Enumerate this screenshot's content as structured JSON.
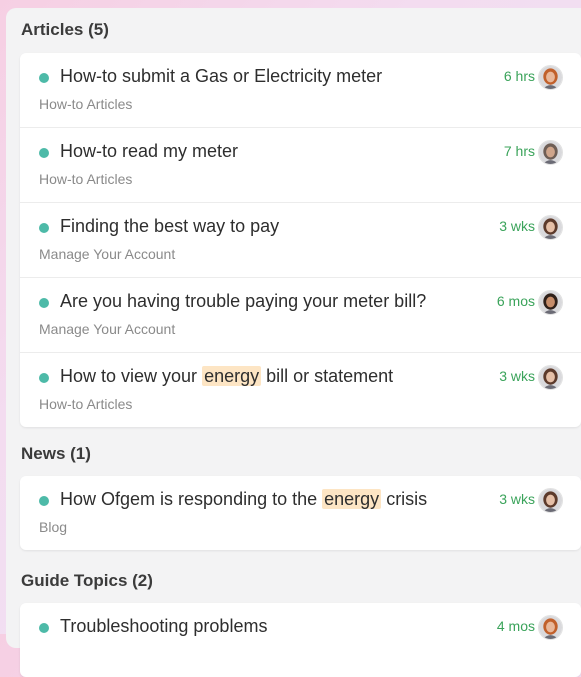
{
  "sections": [
    {
      "heading": "Articles (5)",
      "items": [
        {
          "title_pre": "How-to submit a Gas or Electricity meter",
          "title_hl": "",
          "title_post": "",
          "category": "How-to Articles",
          "time": "6 hrs",
          "avatar": "avatar-redhead-icon",
          "skin": "#e8b79a",
          "hair": "#c1602b"
        },
        {
          "title_pre": "How-to read my meter",
          "title_hl": "",
          "title_post": "",
          "category": "How-to Articles",
          "time": "7 hrs",
          "avatar": "avatar-bald-man-icon",
          "skin": "#cfa58b",
          "hair": "#6e5e55"
        },
        {
          "title_pre": "Finding the best way to pay",
          "title_hl": "",
          "title_post": "",
          "category": "Manage Your Account",
          "time": "3 wks",
          "avatar": "avatar-woman-icon",
          "skin": "#e5bfa7",
          "hair": "#5c3a2b"
        },
        {
          "title_pre": "Are you having trouble paying your meter bill?",
          "title_hl": "",
          "title_post": "",
          "category": "Manage Your Account",
          "time": "6 mos",
          "avatar": "avatar-curly-hair-icon",
          "skin": "#c68d6a",
          "hair": "#2f2019"
        },
        {
          "title_pre": "How to view your ",
          "title_hl": "energy",
          "title_post": " bill or statement",
          "category": "How-to Articles",
          "time": "3 wks",
          "avatar": "avatar-woman-icon",
          "skin": "#e5bfa7",
          "hair": "#5c3a2b"
        }
      ]
    },
    {
      "heading": "News (1)",
      "items": [
        {
          "title_pre": "How Ofgem is responding to the ",
          "title_hl": "energy",
          "title_post": " crisis",
          "category": "Blog",
          "time": "3 wks",
          "avatar": "avatar-woman-icon",
          "skin": "#e5bfa7",
          "hair": "#5c3a2b"
        }
      ]
    },
    {
      "heading": "Guide Topics (2)",
      "items": [
        {
          "title_pre": "Troubleshooting problems",
          "title_hl": "",
          "title_post": "",
          "category": "",
          "time": "4 mos",
          "avatar": "avatar-redhead-icon",
          "skin": "#e8b79a",
          "hair": "#c1602b"
        }
      ]
    }
  ]
}
